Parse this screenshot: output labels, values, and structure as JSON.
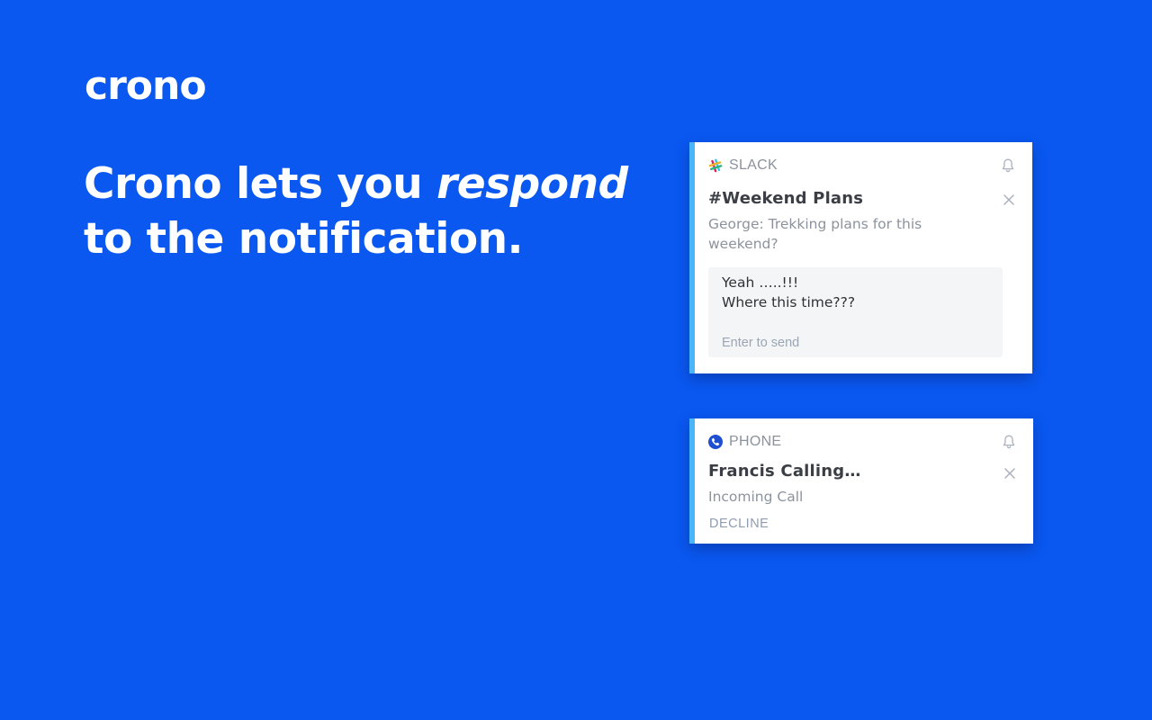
{
  "brand": {
    "logo_text": "crono"
  },
  "headline": {
    "part1": "Crono lets you ",
    "emphasis": "respond",
    "part2": " to the notification."
  },
  "colors": {
    "background": "#0a58f0",
    "card_accent": "#49b6f9",
    "phone_icon": "#1f4fd1"
  },
  "notifications": [
    {
      "app": "SLACK",
      "app_icon": "slack-icon",
      "title": "#Weekend Plans",
      "message": "George: Trekking plans for this weekend?",
      "reply": {
        "value": "Yeah …..!!!\nWhere this time???",
        "placeholder": "Enter to send"
      },
      "bell_icon": "bell-icon",
      "close_icon": "close-icon"
    },
    {
      "app": "PHONE",
      "app_icon": "phone-icon",
      "title": "Francis Calling…",
      "message": "Incoming Call",
      "action": "DECLINE",
      "bell_icon": "bell-icon",
      "close_icon": "close-icon"
    }
  ]
}
